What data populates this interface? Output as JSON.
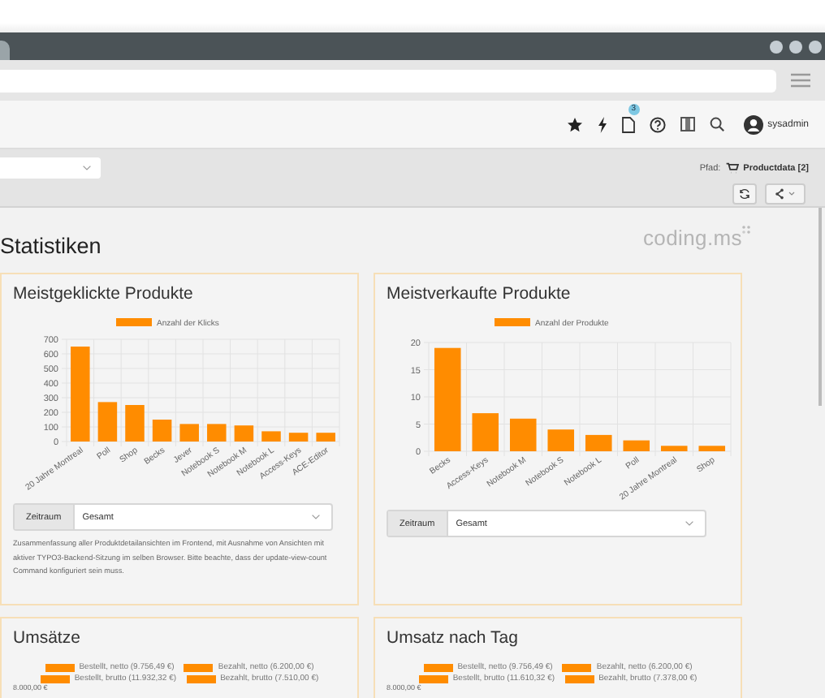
{
  "toolbar": {
    "notification_badge": "3",
    "user": "sysadmin"
  },
  "doc_header": {
    "path_label": "Pfad:",
    "path_value": "Productdata [2]"
  },
  "heading": "Statistiken",
  "logo": "coding.ms",
  "cards": [
    {
      "title": "Meistgeklickte Produkte",
      "chart_data": {
        "type": "bar",
        "categories": [
          "20 Jahre Montreal",
          "Poll",
          "Shop",
          "Becks",
          "Jever",
          "Notebook S",
          "Notebook M",
          "Notebook L",
          "Access-Keys",
          "ACE-Editor"
        ],
        "series": [
          {
            "name": "Anzahl der Klicks",
            "color": "#ff8c00",
            "values": [
              650,
              270,
              250,
              150,
              120,
              120,
              110,
              70,
              60,
              60
            ]
          }
        ],
        "grid": true,
        "ylim": [
          0,
          700
        ],
        "yticks": [
          0,
          100,
          200,
          300,
          400,
          500,
          600,
          700
        ]
      },
      "filter": {
        "label": "Zeitraum",
        "value": "Gesamt"
      },
      "description": "Zusammenfassung aller Produktdetailansichten im Frontend, mit Ausnahme von Ansichten mit aktiver TYPO3-Backend-Sitzung im selben Browser. Bitte beachte, dass der update-view-count Command konfiguriert sein muss."
    },
    {
      "title": "Meistverkaufte Produkte",
      "chart_data": {
        "type": "bar",
        "categories": [
          "Becks",
          "Access-Keys",
          "Notebook M",
          "Notebook S",
          "Notebook L",
          "Poll",
          "20 Jahre Montreal",
          "Shop"
        ],
        "series": [
          {
            "name": "Anzahl der Produkte",
            "color": "#ff8c00",
            "values": [
              19,
              7,
              6,
              4,
              3,
              2,
              1,
              1
            ]
          }
        ],
        "grid": true,
        "ylim": [
          0,
          20
        ],
        "yticks": [
          0,
          5,
          10,
          15,
          20
        ]
      },
      "filter": {
        "label": "Zeitraum",
        "value": "Gesamt"
      }
    }
  ],
  "bottom_cards": [
    {
      "title": "Umsätze",
      "legend": [
        "Bestellt, netto (9.756,49 €)",
        "Bezahlt, netto (6.200,00 €)",
        "Bestellt, brutto (11.932,32 €)",
        "Bezahlt, brutto (7.510,00 €)"
      ],
      "axis_label": "8.000,00 €"
    },
    {
      "title": "Umsatz nach Tag",
      "legend": [
        "Bestellt, netto (9.756,49 €)",
        "Bezahlt, netto (6.200,00 €)",
        "Bestellt, brutto (11.610,32 €)",
        "Bezahlt, brutto (7.378,00 €)"
      ],
      "axis_label": "8.000,00 €"
    }
  ]
}
